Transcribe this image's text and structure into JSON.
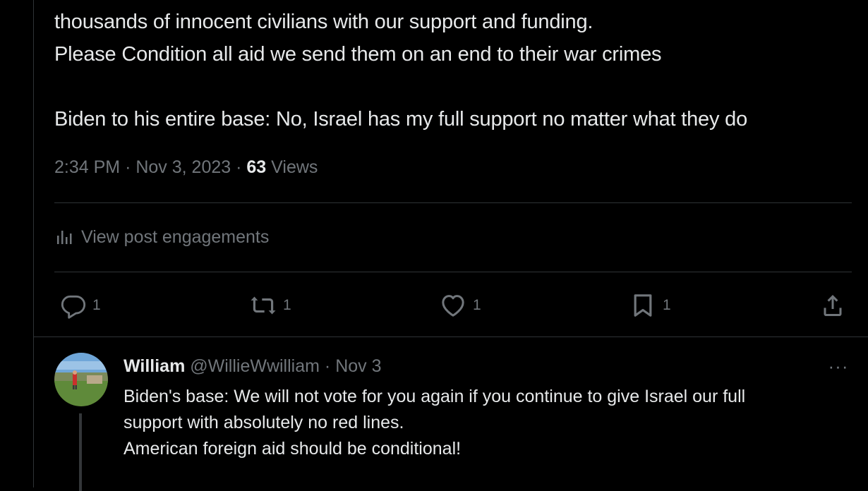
{
  "post": {
    "lines": [
      "thousands of innocent civilians with our support and funding.",
      "Please Condition all aid we send them on an end to their war crimes",
      "",
      "Biden to his entire base: No, Israel has my full support no matter what they do"
    ],
    "time": "2:34 PM",
    "date": "Nov 3, 2023",
    "views_count": "63",
    "views_label": "Views",
    "separator": "·"
  },
  "engagements": {
    "label": "View post engagements",
    "icon": "analytics-icon"
  },
  "actions": {
    "reply": {
      "icon": "reply-icon",
      "count": "1"
    },
    "repost": {
      "icon": "repost-icon",
      "count": "1"
    },
    "like": {
      "icon": "heart-icon",
      "count": "1"
    },
    "bookmark": {
      "icon": "bookmark-icon",
      "count": "1"
    },
    "share": {
      "icon": "share-icon"
    }
  },
  "reply": {
    "name": "William",
    "handle": "@WillieWwilliam",
    "date": "Nov 3",
    "separator": "·",
    "more_label": "···",
    "lines": [
      "Biden's base: We will not vote for you again if you continue to give Israel our full",
      "support with absolutely no red lines.",
      "American foreign aid should be conditional!"
    ]
  },
  "colors": {
    "background": "#000000",
    "text_primary": "#e7e9ea",
    "text_secondary": "#71767b",
    "border": "#2f3336"
  }
}
